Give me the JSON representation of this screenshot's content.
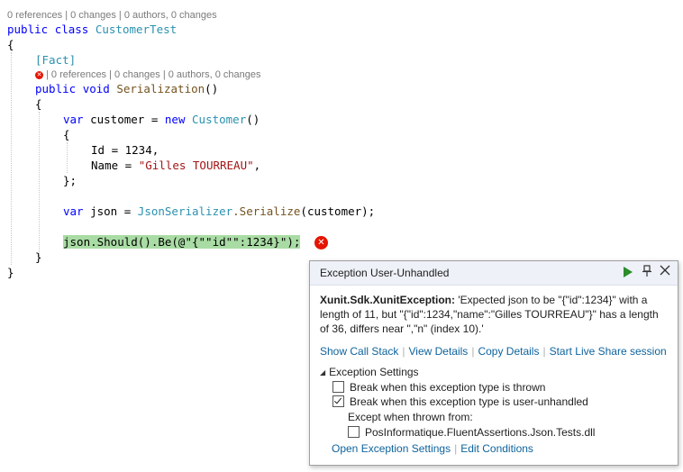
{
  "codelens": {
    "class_lens": "0 references | 0 changes | 0 authors, 0 changes",
    "method_lens": "| 0 references | 0 changes | 0 authors, 0 changes"
  },
  "code": {
    "kw_public": "public",
    "kw_class": "class",
    "class_name": "CustomerTest",
    "brace_open": "{",
    "brace_close": "}",
    "attr_fact": "[Fact]",
    "kw_void": "void",
    "method_name": "Serialization",
    "parens": "()",
    "kw_var": "var",
    "var_customer": "customer =",
    "kw_new": "new",
    "type_customer": "Customer",
    "id_line": "Id = 1234,",
    "name_prefix": "Name = ",
    "name_value": "\"Gilles TOURREAU\"",
    "name_suffix": ",",
    "init_close": "};",
    "var_json": "json =",
    "serializer_type": "JsonSerializer",
    "serialize_call": ".Serialize",
    "serialize_args": "(customer);",
    "assert_line": "json.Should().Be(@\"{\"\"id\"\":1234}\");"
  },
  "popup": {
    "title": "Exception User-Unhandled",
    "exception_type": "Xunit.Sdk.XunitException:",
    "message_line1": " 'Expected json to be \"{\"id\":1234}\" with a",
    "message_line2": "length of 11, but \"{\"id\":1234,\"name\":\"Gilles TOURREAU\"}\" has a length",
    "message_line3": "of 36, differs near \",\"n\" (index 10).'",
    "links": [
      "Show Call Stack",
      "View Details",
      "Copy Details",
      "Start Live Share session"
    ],
    "settings_header": "Exception Settings",
    "break_thrown": "Break when this exception type is thrown",
    "break_user_unhandled": "Break when this exception type is user-unhandled",
    "except_when": "Except when thrown from:",
    "except_module": "PosInformatique.FluentAssertions.Json.Tests.dll",
    "bottom_links": [
      "Open Exception Settings",
      "Edit Conditions"
    ],
    "states": {
      "break_thrown": false,
      "break_user_unhandled": true,
      "except_module": false
    }
  },
  "icons": {
    "error": "error-icon",
    "continue": "play-icon",
    "pin": "pin-icon",
    "close": "close-icon"
  },
  "colors": {
    "keyword": "#0000ff",
    "type": "#2b91af",
    "string": "#a31515",
    "error": "#e51400",
    "highlight": "#a9dca4",
    "link": "#0e639c"
  }
}
